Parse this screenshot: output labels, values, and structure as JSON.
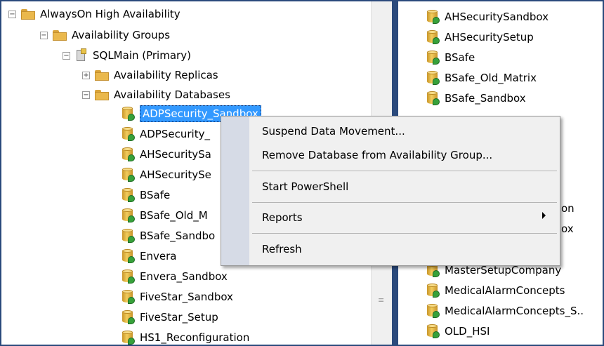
{
  "tree": {
    "root": {
      "label": "AlwaysOn High Availability",
      "expanded": true
    },
    "groups": {
      "label": "Availability Groups",
      "expanded": true
    },
    "server": {
      "label": "SQLMain (Primary)",
      "expanded": true
    },
    "replicas": {
      "label": "Availability Replicas",
      "expanded": false
    },
    "databases": {
      "label": "Availability Databases",
      "expanded": true
    },
    "db_items": [
      {
        "label": "ADPSecurity_Sandbox",
        "selected": true
      },
      {
        "label": "ADPSecurity_"
      },
      {
        "label": "AHSecuritySa"
      },
      {
        "label": "AHSecuritySe"
      },
      {
        "label": "BSafe"
      },
      {
        "label": "BSafe_Old_M"
      },
      {
        "label": "BSafe_Sandbo"
      },
      {
        "label": "Envera"
      },
      {
        "label": "Envera_Sandbox"
      },
      {
        "label": "FiveStar_Sandbox"
      },
      {
        "label": "FiveStar_Setup"
      },
      {
        "label": "HS1_Reconfiguration"
      }
    ],
    "expand_glyphs": {
      "expanded": "−",
      "collapsed": "+"
    }
  },
  "right_list": {
    "items_top": [
      "AHSecuritySandbox",
      "AHSecuritySetup",
      "BSafe",
      "BSafe_Old_Matrix",
      "BSafe_Sandbox"
    ],
    "partial_1": "on",
    "partial_2": "ox",
    "items_bottom": [
      "MasterSetupCompany",
      "MedicalAlarmConcepts",
      "MedicalAlarmConcepts_S..",
      "OLD_HSI"
    ]
  },
  "context_menu": {
    "suspend": "Suspend Data Movement...",
    "remove": "Remove Database from Availability Group...",
    "powershell": "Start PowerShell",
    "reports": "Reports",
    "refresh": "Refresh"
  },
  "colors": {
    "selection": "#3399ff",
    "frame": "#2b4a7c",
    "menu_bg": "#f0f0f0",
    "menu_gutter": "#d6dbe6"
  },
  "icons": [
    "folder-icon",
    "server-icon",
    "database-icon",
    "expand-icon",
    "collapse-icon",
    "submenu-arrow-icon",
    "scrollbar-grip-icon"
  ]
}
